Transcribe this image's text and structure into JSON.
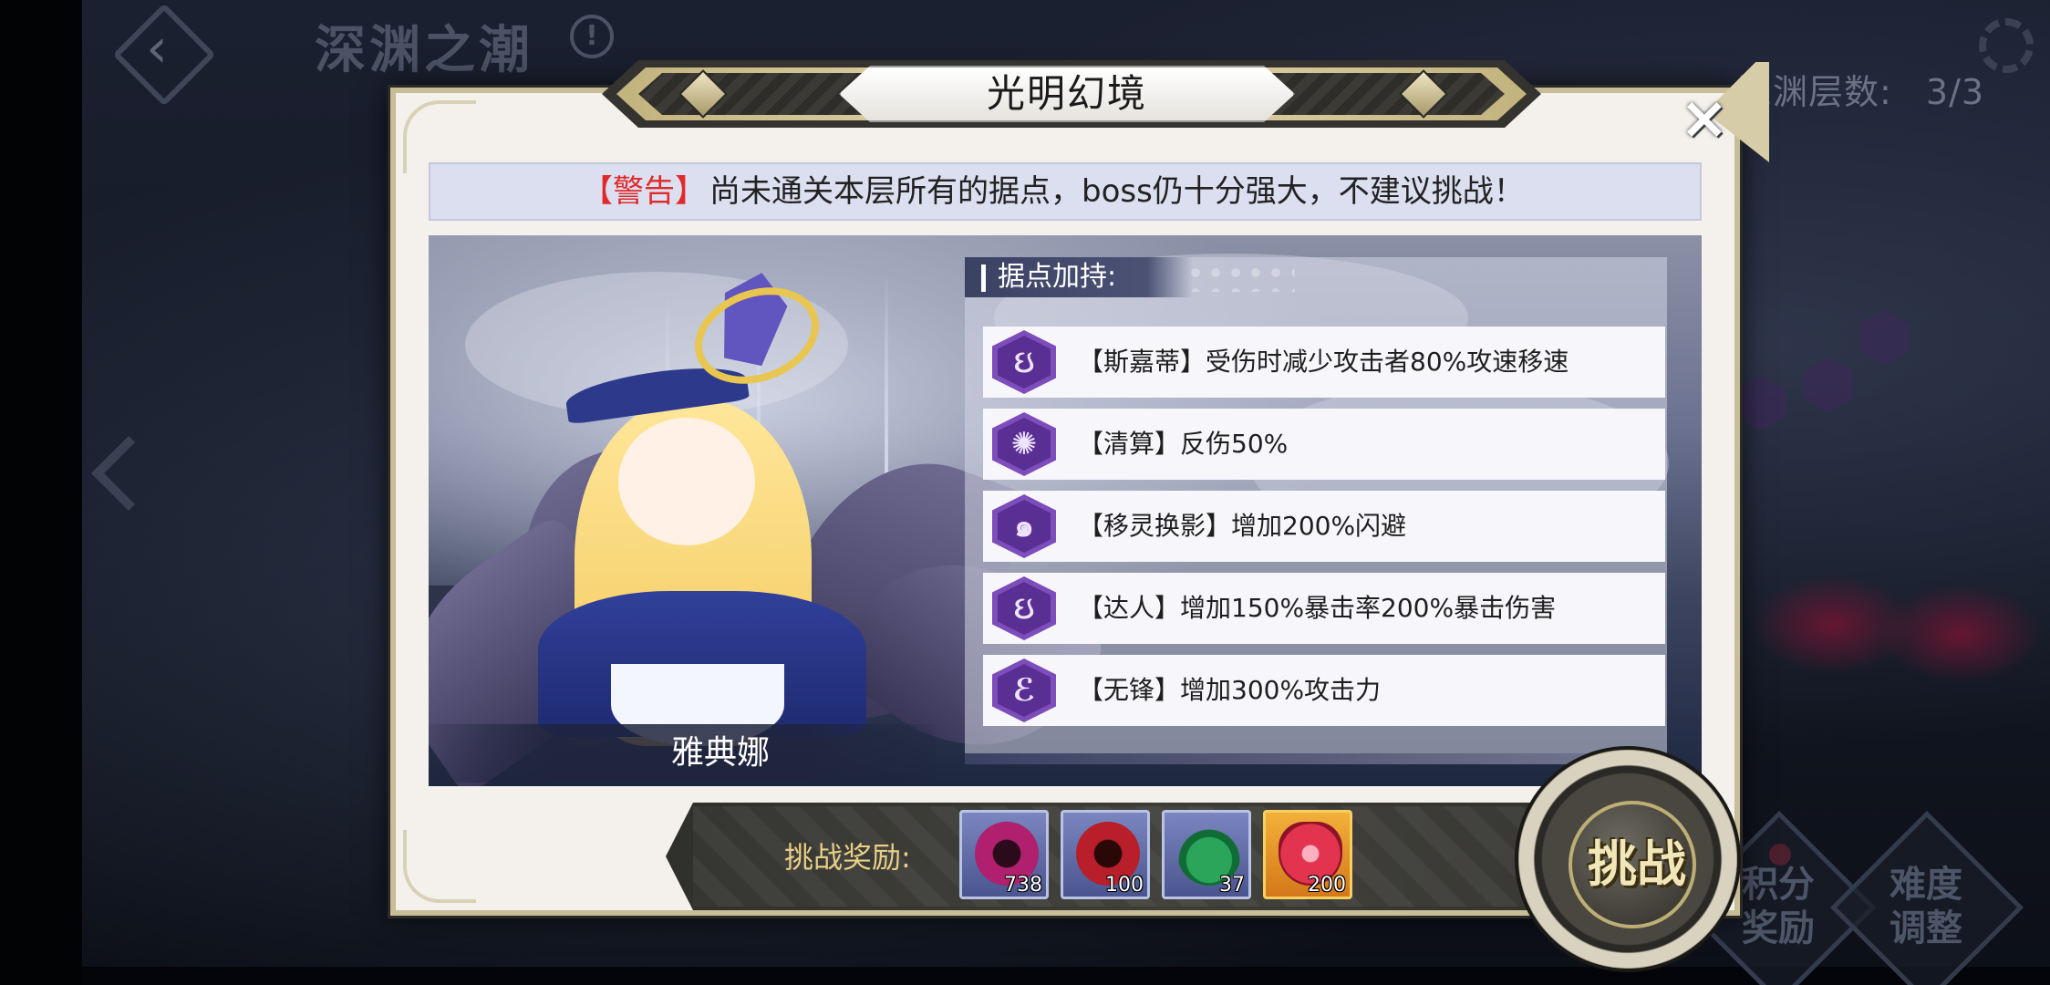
{
  "background": {
    "screen_title": "深渊之潮",
    "info_icon": "!",
    "layer_label": "深渊层数:",
    "layer_value": "3/3",
    "bottom_buttons": [
      {
        "label_line1": "积分",
        "label_line2": "奖励"
      },
      {
        "label_line1": "难度",
        "label_line2": "调整"
      }
    ]
  },
  "dialog": {
    "title": "光明幻境",
    "close_label": "×",
    "warning": {
      "tag": "【警告】",
      "text": "尚未通关本层所有的据点，boss仍十分强大，不建议挑战！"
    },
    "boss": {
      "name": "雅典娜"
    },
    "buffs": {
      "header": "据点加持:",
      "items": [
        {
          "text": "【斯嘉蒂】受伤时减少攻击者80%攻速移速",
          "glyph": "ઇ"
        },
        {
          "text": "【清算】反伤50%",
          "glyph": "✺"
        },
        {
          "text": "【移灵换影】增加200%闪避",
          "glyph": "๑"
        },
        {
          "text": "【达人】增加150%暴击率200%暴击伤害",
          "glyph": "ઇ"
        },
        {
          "text": "【无锋】增加300%攻击力",
          "glyph": "ℰ"
        }
      ]
    },
    "rewards": {
      "label": "挑战奖励:",
      "items": [
        {
          "name": "magenta-gear-item",
          "count": "738",
          "color": "#b0206e"
        },
        {
          "name": "red-gear-item",
          "count": "100",
          "color": "#b81f2a"
        },
        {
          "name": "green-potion-item",
          "count": "37",
          "color": "#2aa55a"
        },
        {
          "name": "red-crystal-item",
          "count": "200",
          "color": "#e2344f"
        }
      ]
    },
    "challenge_button": "挑战"
  },
  "colors": {
    "warning_red": "#e02a2a",
    "buff_purple": "#7d4dbb",
    "reward_label_gold": "#e7cf86",
    "dialog_border": "#c7bd97"
  }
}
